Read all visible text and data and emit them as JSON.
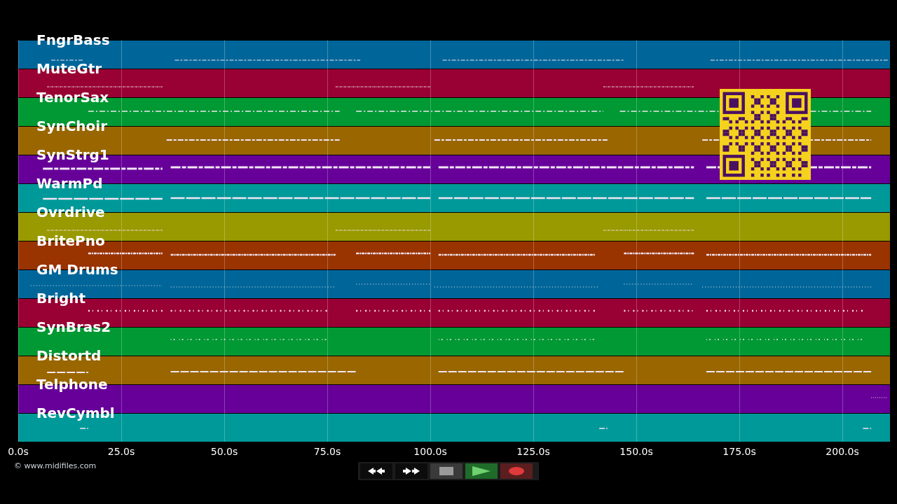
{
  "tracks": [
    {
      "name": "FngrBass",
      "color": "#00669a"
    },
    {
      "name": "MuteGtr",
      "color": "#990033"
    },
    {
      "name": "TenorSax",
      "color": "#009933"
    },
    {
      "name": "SynChoir",
      "color": "#996600"
    },
    {
      "name": "SynStrg1",
      "color": "#660099"
    },
    {
      "name": "WarmPd",
      "color": "#009999"
    },
    {
      "name": "Ovrdrive",
      "color": "#999900"
    },
    {
      "name": "BritePno",
      "color": "#993300"
    },
    {
      "name": "GM Drums",
      "color": "#006699"
    },
    {
      "name": "Bright",
      "color": "#990033"
    },
    {
      "name": "SynBras2",
      "color": "#009933"
    },
    {
      "name": "Distortd",
      "color": "#996600"
    },
    {
      "name": "Telphone",
      "color": "#660099"
    },
    {
      "name": "RevCymbl",
      "color": "#009999"
    }
  ],
  "time_axis": [
    "0.0s",
    "25.0s",
    "50.0s",
    "75.0s",
    "100.0s",
    "125.0s",
    "150.0s",
    "175.0s",
    "200.0s"
  ],
  "copyright": "© www.midifiles.com"
}
